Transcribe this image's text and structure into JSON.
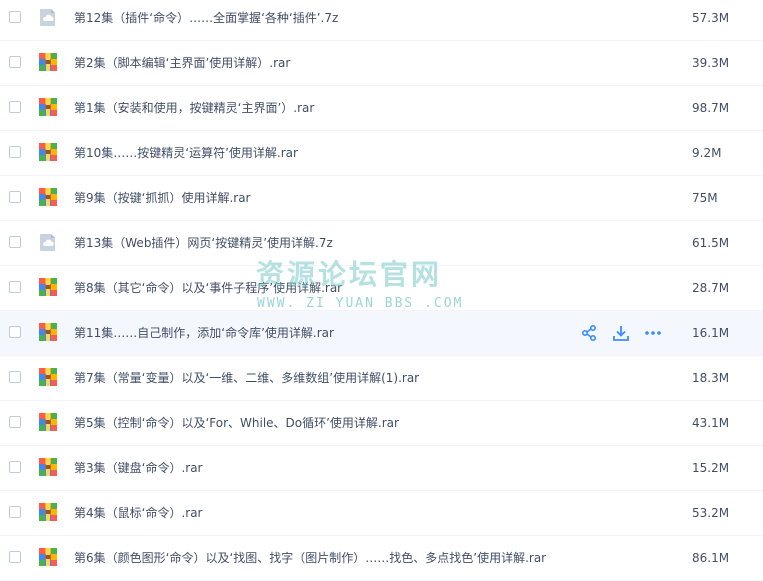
{
  "files": [
    {
      "name": "第12集（插件‘命令）……全面掌握‘各种‘插件’.7z",
      "size": "57.3M",
      "type": "7z"
    },
    {
      "name": "第2集（脚本编辑‘主界面’使用详解）.rar",
      "size": "39.3M",
      "type": "rar"
    },
    {
      "name": "第1集（安装和使用，按键精灵‘主界面’）.rar",
      "size": "98.7M",
      "type": "rar"
    },
    {
      "name": "第10集……按键精灵‘运算符’使用详解.rar",
      "size": "9.2M",
      "type": "rar"
    },
    {
      "name": "第9集（按键‘抓抓）使用详解.rar",
      "size": "75M",
      "type": "rar"
    },
    {
      "name": "第13集（Web插件）网页‘按键精灵’使用详解.7z",
      "size": "61.5M",
      "type": "7z"
    },
    {
      "name": "第8集（其它‘命令）以及‘事件子程序’使用详解.rar",
      "size": "28.7M",
      "type": "rar"
    },
    {
      "name": "第11集……自己制作，添加‘命令库’使用详解.rar",
      "size": "16.1M",
      "type": "rar"
    },
    {
      "name": "第7集（常量‘变量）以及‘一维、二维、多维数组’使用详解(1).rar",
      "size": "18.3M",
      "type": "rar"
    },
    {
      "name": "第5集（控制‘命令）以及‘For、While、Do循环’使用详解.rar",
      "size": "43.1M",
      "type": "rar"
    },
    {
      "name": "第3集（键盘‘命令）.rar",
      "size": "15.2M",
      "type": "rar"
    },
    {
      "name": "第4集（鼠标‘命令）.rar",
      "size": "53.2M",
      "type": "rar"
    },
    {
      "name": "第6集（颜色图形‘命令）以及‘找图、找字（图片制作）……找色、多点找色’使用详解.rar",
      "size": "86.1M",
      "type": "rar"
    }
  ],
  "hover_row_index": 7,
  "row_actions": [
    "share-icon",
    "download-icon",
    "more-icon"
  ],
  "watermark": {
    "title": "资源论坛官网",
    "url": "WWW. ZI YUAN BBS .COM"
  },
  "colors": {
    "text": "#424e67",
    "hover_row": "#f4f8fe",
    "action_icon": "#3b8cff",
    "watermark": "#78c8c8"
  }
}
